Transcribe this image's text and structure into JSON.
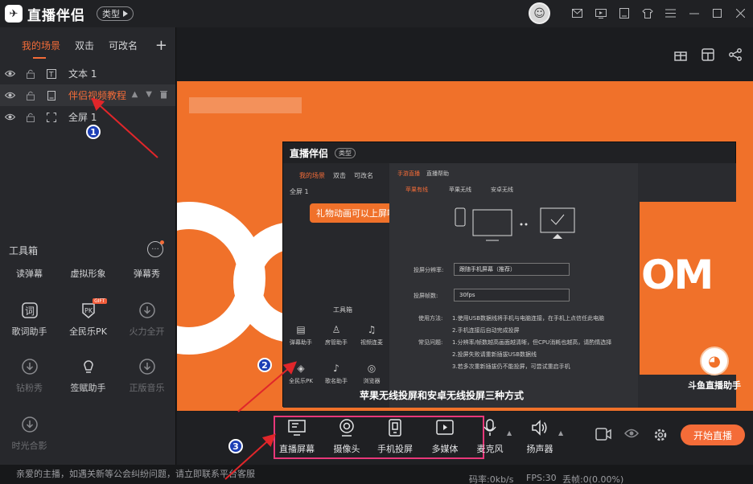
{
  "titlebar": {
    "logo_mark": "✈",
    "app_name": "直播伴侣",
    "type_button": "类型"
  },
  "scenes": {
    "tabs": [
      {
        "label": "我的场景",
        "active": true
      },
      {
        "label": "双击"
      },
      {
        "label": "可改名"
      }
    ],
    "add": "+",
    "items": [
      {
        "label": "文本 1"
      },
      {
        "label": "伴侣视频教程",
        "selected": true
      },
      {
        "label": "全屏 1"
      }
    ]
  },
  "toolbox": {
    "title": "工具箱",
    "items": [
      {
        "label": "读弹幕"
      },
      {
        "label": "虚拟形象"
      },
      {
        "label": "弹幕秀"
      },
      {
        "label": "歌词助手"
      },
      {
        "label": "全民乐PK",
        "badge": "GIFT"
      },
      {
        "label": "火力全开"
      },
      {
        "label": "钻粉秀"
      },
      {
        "label": "签赋助手"
      },
      {
        "label": "正版音乐"
      },
      {
        "label": "时光合影"
      }
    ]
  },
  "preview": {
    "inner_window": {
      "app_name": "直播伴侣",
      "type_button": "类型",
      "tabs": [
        "我的场景",
        "双击",
        "可改名"
      ],
      "scene": "全屏 1",
      "bubble": "礼物动画可以上屏啦~",
      "bubble_close": "✕",
      "toolbox_title": "工具箱",
      "tools": [
        "弹幕助手",
        "房管助手",
        "视频连麦",
        "全民乐PK",
        "歌名助手",
        "浏览器"
      ],
      "main_tabs": [
        "手游直播",
        "直播帮助"
      ],
      "methods": [
        "苹果有线",
        "苹果无线",
        "安卓无线"
      ],
      "resolution_label": "投屏分辨率:",
      "resolution_value": "跟随手机屏幕（推荐）",
      "fps_label": "投屏帧数:",
      "fps_value": "30fps",
      "usage_label": "使用方法:",
      "usage_text": "1.使用USB数据线将手机与电脑连接，在手机上点信任此电脑",
      "usage_text2": "2.手机连接后自动完成投屏",
      "faq_label": "常见问题:",
      "faq_1": "1.分辨率/帧数越高画面越清晰，但CPU消耗也越高，请酌情选择",
      "faq_2": "2.投屏失败请重新插拔USB数据线",
      "faq_3": "3.若多次重新插拔仍不能投屏，可尝试重启手机",
      "caption": "苹果无线投屏和安卓无线投屏三种方式"
    },
    "watermark": "斗鱼直播助手"
  },
  "sources": {
    "items": [
      {
        "label": "直播屏幕"
      },
      {
        "label": "摄像头"
      },
      {
        "label": "手机投屏"
      },
      {
        "label": "多媒体"
      },
      {
        "label": "麦克风"
      },
      {
        "label": "扬声器"
      }
    ],
    "start_button": "开始直播"
  },
  "status": {
    "message": "亲爱的主播，如遇关新等公会纠纷问题，请立即联系平台客服",
    "bitrate": "码率:0kb/s",
    "fps": "FPS:30",
    "drop": "丢帧:0(0.00%)"
  },
  "annotations": [
    "1",
    "2",
    "3"
  ],
  "colors": {
    "accent": "#f46c38",
    "highlight_box": "#e8387a",
    "arrow": "#e0262a",
    "annotation": "#1d3fb5"
  }
}
